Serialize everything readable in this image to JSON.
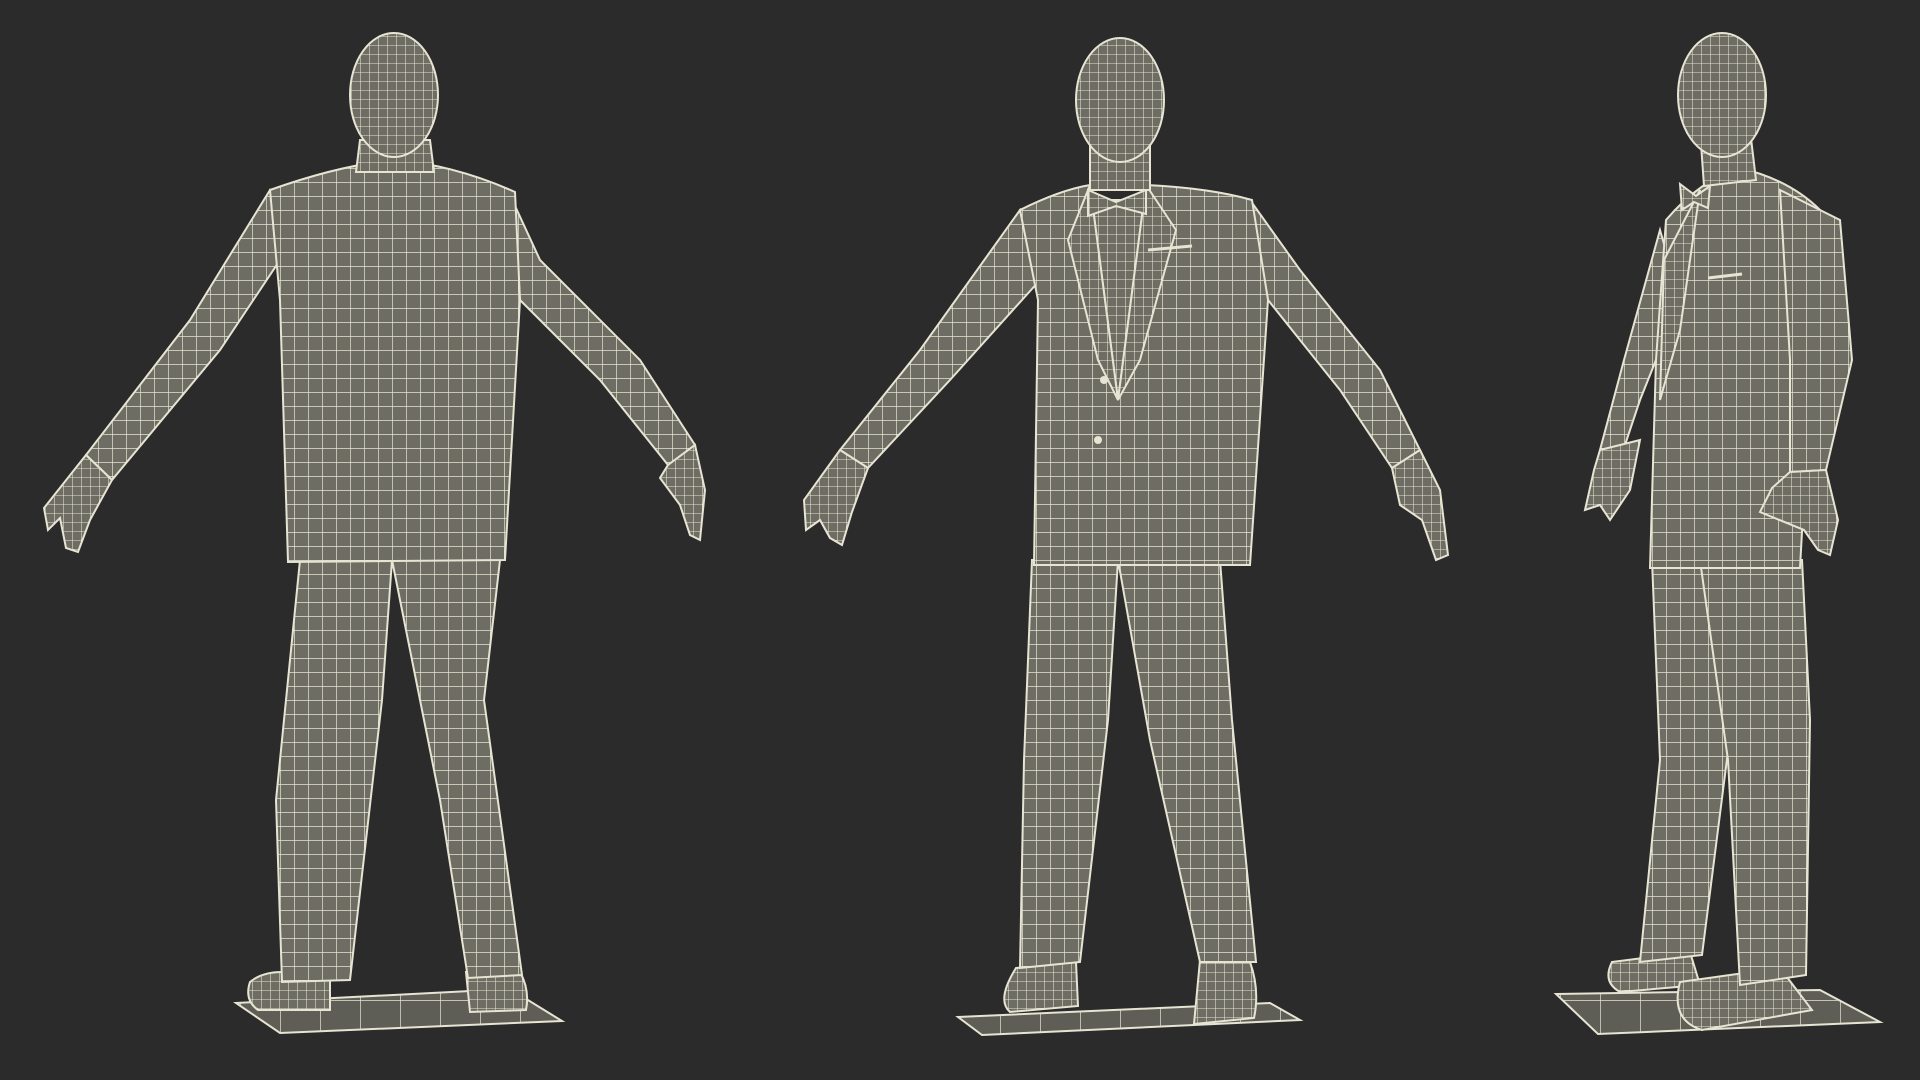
{
  "scene": {
    "background_color": "#2b2b2b",
    "body_fill_color": "#6e6d63",
    "wire_color": "#e6e4d2",
    "base_fill_color": "#5f5e56",
    "views": [
      {
        "view": "back"
      },
      {
        "view": "front"
      },
      {
        "view": "three-quarter"
      }
    ]
  }
}
